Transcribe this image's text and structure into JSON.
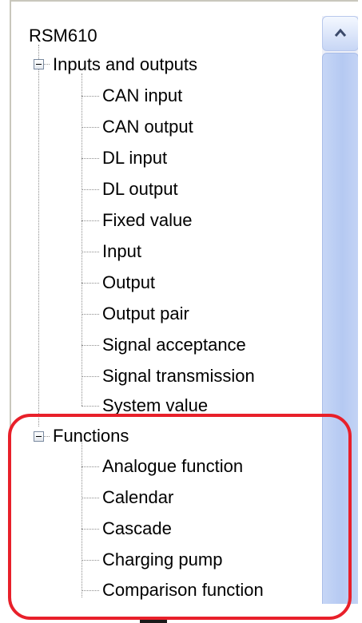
{
  "tree": {
    "root_label": "RSM610",
    "groups": [
      {
        "label": "Inputs and outputs",
        "expanded": true,
        "items": [
          "CAN input",
          "CAN output",
          "DL input",
          "DL output",
          "Fixed value",
          "Input",
          "Output",
          "Output pair",
          "Signal acceptance",
          "Signal transmission",
          "System value"
        ]
      },
      {
        "label": "Functions",
        "expanded": true,
        "items": [
          "Analogue function",
          "Calendar",
          "Cascade",
          "Charging pump",
          "Comparison function"
        ]
      }
    ]
  },
  "icons": {
    "expander": "minus-box-icon",
    "scroll_up": "chevron-up-icon"
  },
  "colors": {
    "highlight": "#e8202a",
    "scroll_thumb": "#b5c9f2",
    "frame": "#c9c7bc"
  }
}
